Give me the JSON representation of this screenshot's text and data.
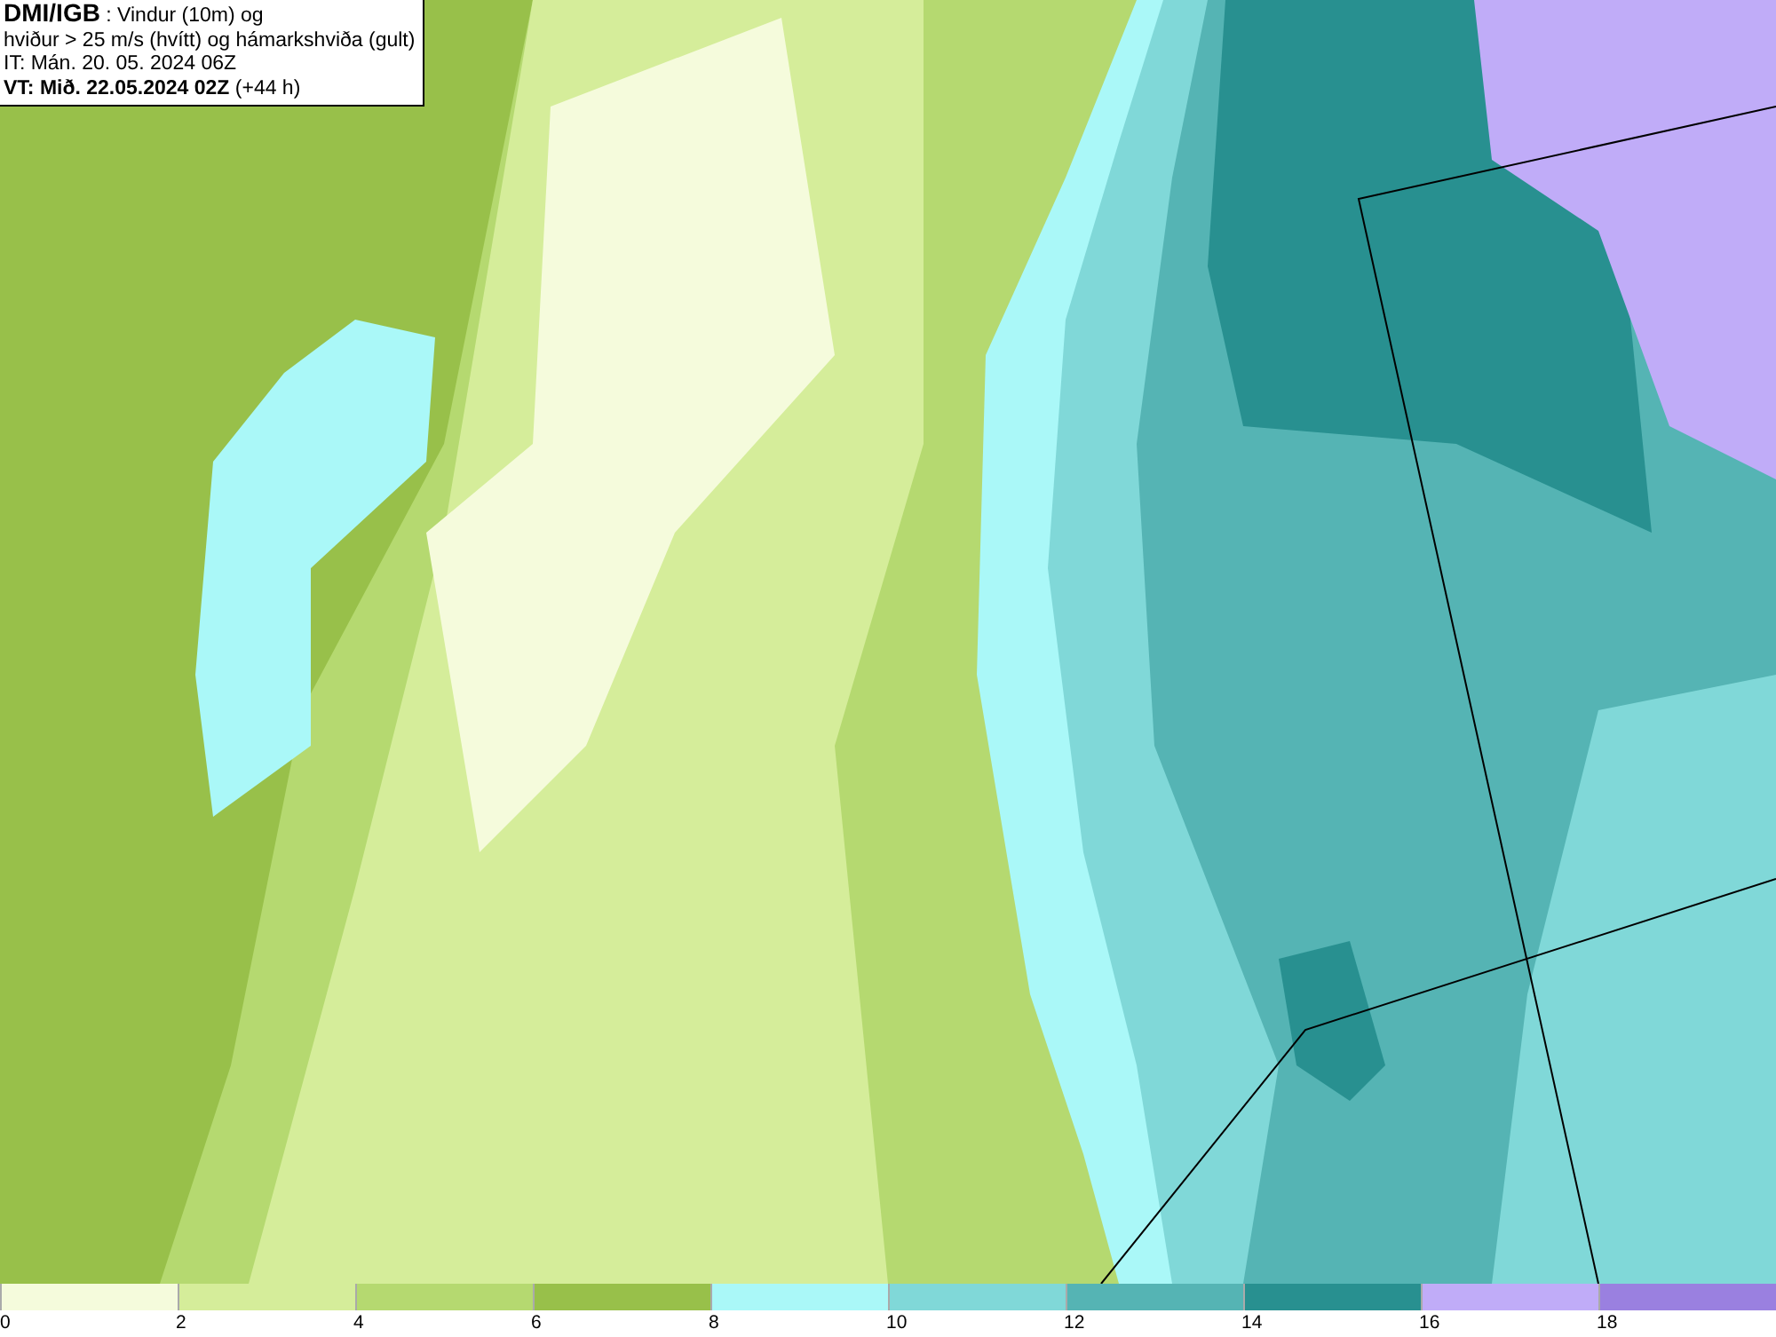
{
  "header": {
    "lines": [
      "**DMI/IGB** : Vindur (10m) og",
      "hviður > 25 m/s (hvítt) og hámarkshviða (gult)",
      "IT: Mán. 20. 05. 2024 06Z",
      "**VT: Mið. 22.05.2024 02Z** (+44 h)"
    ]
  },
  "legend": {
    "bins": [
      {
        "label": "0",
        "color": "#f5fbdc"
      },
      {
        "label": "2",
        "color": "#d5ed9a"
      },
      {
        "label": "4",
        "color": "#b5d970"
      },
      {
        "label": "6",
        "color": "#98c04a"
      },
      {
        "label": "8",
        "color": "#aaf8f8"
      },
      {
        "label": "10",
        "color": "#80d8d8"
      },
      {
        "label": "12",
        "color": "#55b4b4"
      },
      {
        "label": "14",
        "color": "#289090"
      },
      {
        "label": "16",
        "color": "#c0acf8"
      },
      {
        "label": "18",
        "color": "#9a80e0"
      }
    ]
  }
}
